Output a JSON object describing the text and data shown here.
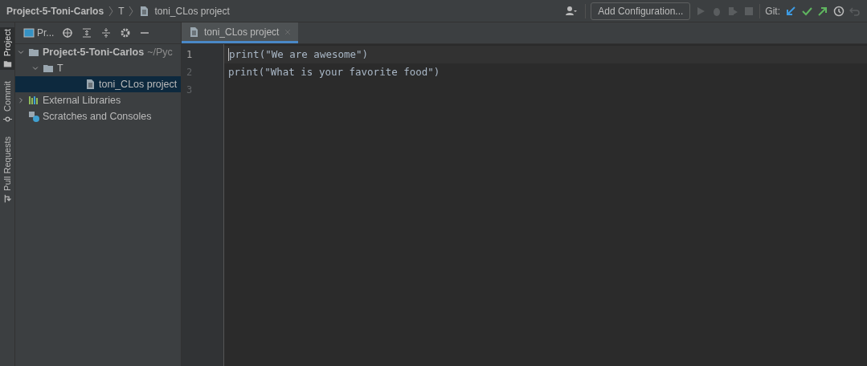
{
  "breadcrumbs": [
    {
      "label": "Project-5-Toni-Carlos",
      "kind": "root"
    },
    {
      "label": "T",
      "kind": "folder"
    },
    {
      "label": "toni_CLos project",
      "kind": "file"
    }
  ],
  "toolbar": {
    "configuration_button": "Add Configuration...",
    "git_label": "Git:"
  },
  "side_tabs": [
    {
      "label": "Project",
      "selected": true,
      "kind": "folder"
    },
    {
      "label": "Commit",
      "selected": false,
      "kind": "commit"
    },
    {
      "label": "Pull Requests",
      "selected": false,
      "kind": "pull"
    }
  ],
  "project_panel": {
    "view_selector": "Pr...",
    "tree": [
      {
        "label": "Project-5-Toni-Carlos",
        "path": "~/Pyc",
        "kind": "folder",
        "expanded": true,
        "selected": false,
        "children": [
          {
            "label": "T",
            "kind": "folder",
            "expanded": true,
            "selected": false,
            "children": [
              {
                "label": "toni_CLos project",
                "kind": "file",
                "selected": true
              }
            ]
          }
        ]
      },
      {
        "label": "External Libraries",
        "kind": "libraries",
        "expanded": false,
        "selected": false
      },
      {
        "label": "Scratches and Consoles",
        "kind": "scratches",
        "selected": false
      }
    ]
  },
  "editor_tabs": [
    {
      "label": "toni_CLos project",
      "selected": true
    }
  ],
  "editor": {
    "lines": [
      {
        "number": "1",
        "code": "print(\"We are awesome\")",
        "current": true
      },
      {
        "number": "2",
        "code": "print(\"What is your favorite food\")",
        "current": false
      },
      {
        "number": "3",
        "current": false
      }
    ]
  }
}
